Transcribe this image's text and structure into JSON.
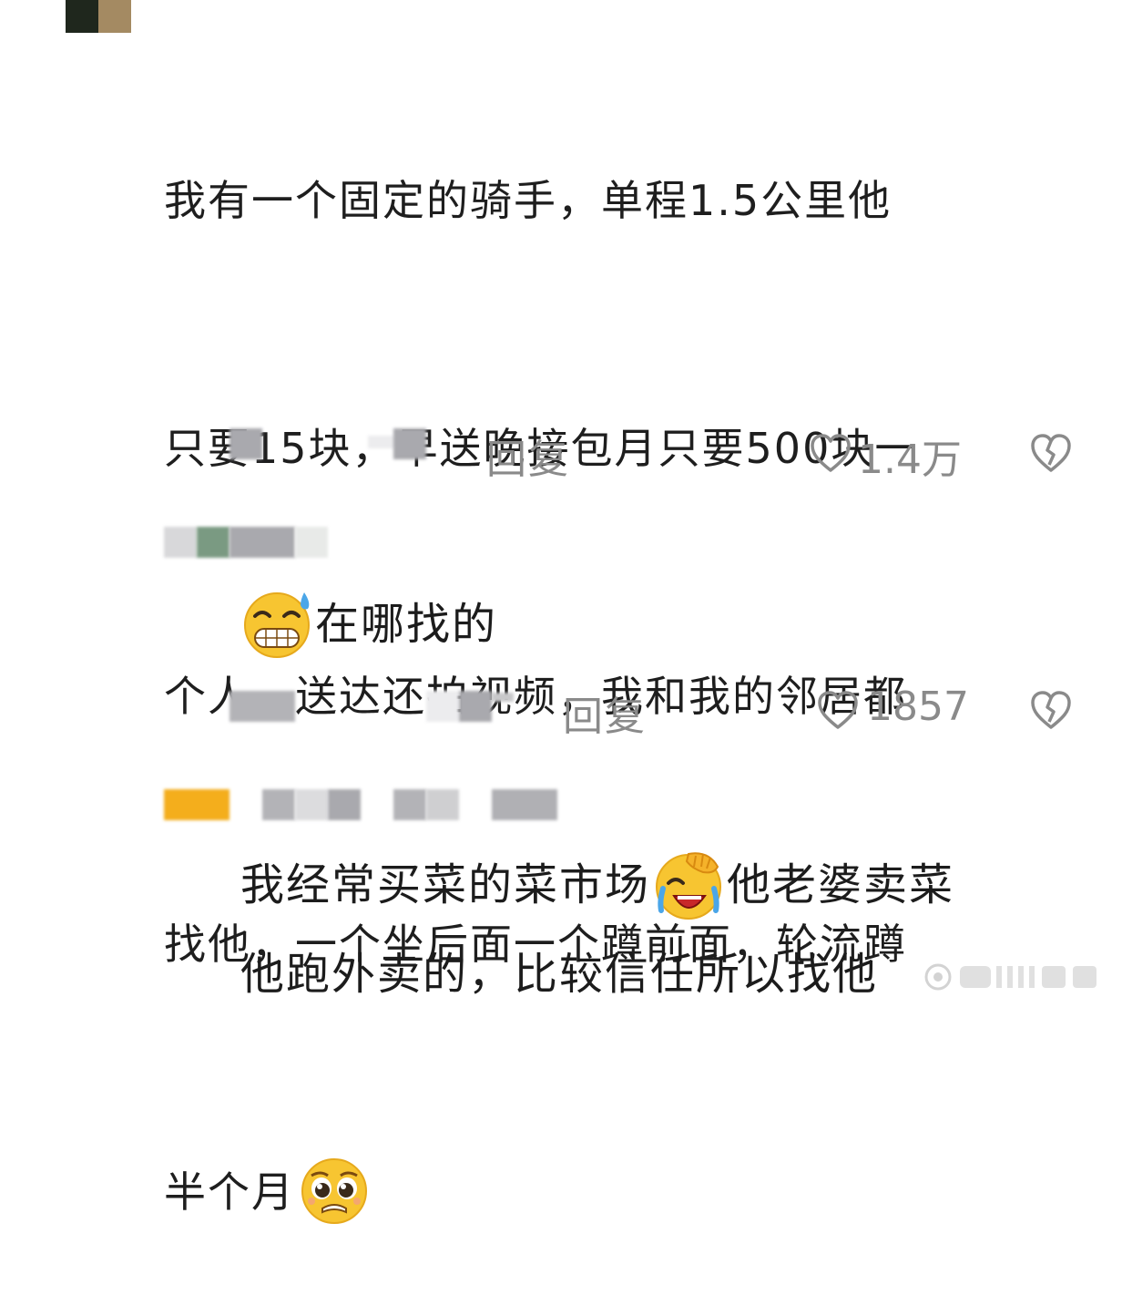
{
  "comment1": {
    "lines": [
      "我有一个固定的骑手，单程1.5公里他",
      "只要15块，早送晚接包月只要500块一",
      "个人，送达还拍视频，我和我的邻居都",
      "找他，一个坐后面一个蹲前面，轮流蹲",
      "半个月"
    ],
    "emoji": "pleading-face-emoji",
    "reply_label": "回复",
    "like_count": "1.4万"
  },
  "comment2": {
    "text": "在哪找的",
    "emoji": "grimacing-sweat-emoji",
    "reply_label": "回复",
    "like_count": "1857"
  },
  "comment3": {
    "line1_before": "我经常买菜的菜市场",
    "line1_after": "他老婆卖菜",
    "line2": "他跑外卖的，比较信任所以找他",
    "emoji": "laughing-facepalm-emoji"
  },
  "icons": {
    "like": "heart-outline-icon",
    "dislike": "broken-heart-icon"
  },
  "colors": {
    "text": "#1e1e1e",
    "meta": "#8a8a8a",
    "emoji_yellow": "#f7c531"
  }
}
